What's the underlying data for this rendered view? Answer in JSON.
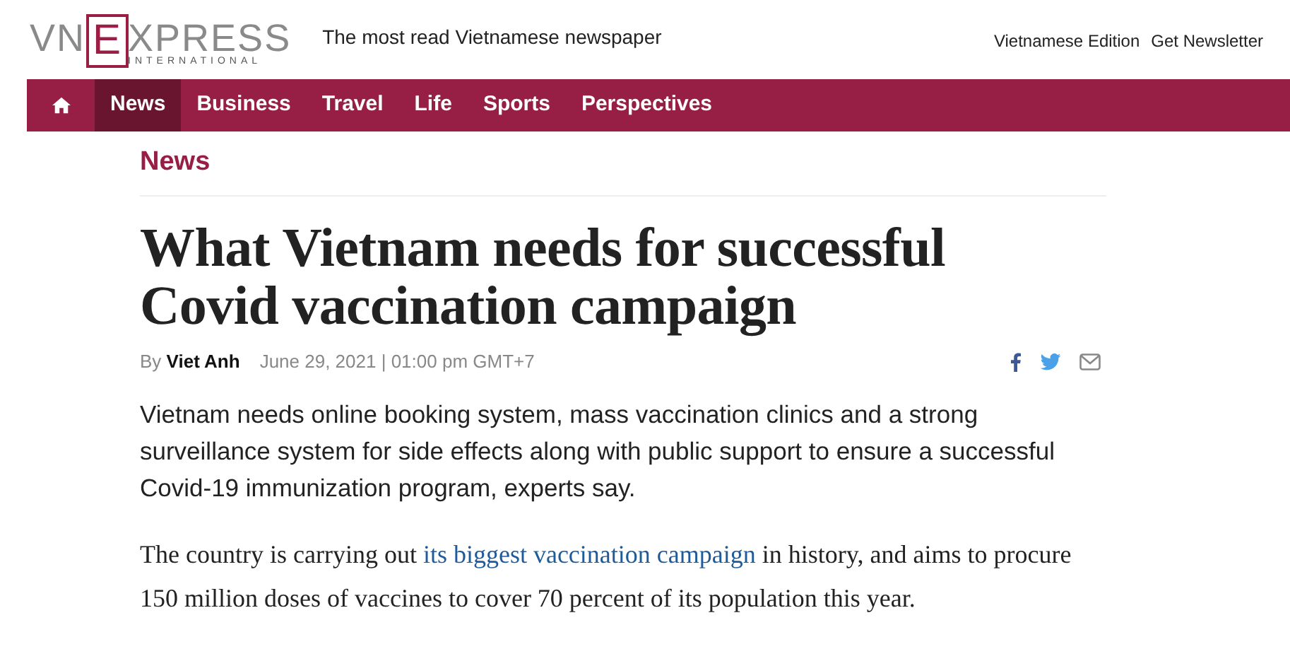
{
  "logo": {
    "left": "VN",
    "boxed": "E",
    "right": "XPRESS",
    "sub": "INTERNATIONAL"
  },
  "tagline": "The most read Vietnamese newspaper",
  "top_links": [
    "Vietnamese Edition",
    "Get Newsletter"
  ],
  "nav": [
    {
      "label": "News",
      "selected": true
    },
    {
      "label": "Business",
      "selected": false
    },
    {
      "label": "Travel",
      "selected": false
    },
    {
      "label": "Life",
      "selected": false
    },
    {
      "label": "Sports",
      "selected": false
    },
    {
      "label": "Perspectives",
      "selected": false
    }
  ],
  "section": "News",
  "headline": "What Vietnam needs for successful Covid vaccination campaign",
  "byline": {
    "prefix": "By",
    "author": "Viet Anh",
    "date": "June 29, 2021 | 01:00 pm GMT+7"
  },
  "lead": "Vietnam needs online booking system, mass vaccination clinics and a strong surveillance system for side effects along with public support to ensure a successful Covid-19 immunization program, experts say.",
  "body": {
    "before": "The country is carrying out ",
    "link": "its biggest vaccination campaign",
    "after": " in history, and aims to procure 150 million doses of vaccines to cover 70 percent of its population this year."
  }
}
